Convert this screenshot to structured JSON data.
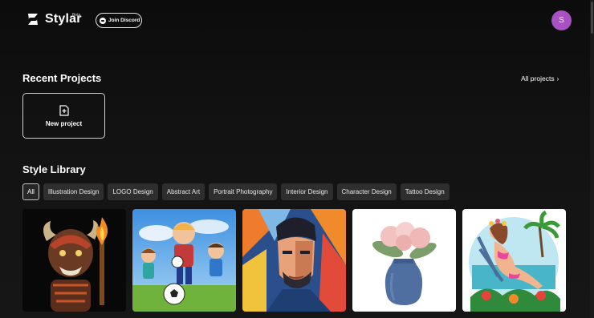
{
  "brand": {
    "name": "Stylar",
    "badge": "Beta"
  },
  "header": {
    "discord_label": "Join Discord",
    "avatar_initial": "S"
  },
  "recent": {
    "title": "Recent Projects",
    "all_projects_label": "All projects",
    "new_project_label": "New project"
  },
  "library": {
    "title": "Style Library",
    "categories": [
      "All",
      "Illustration Design",
      "LOGO Design",
      "Abstract Art",
      "Portrait Photography",
      "Interior Design",
      "Character Design",
      "Tattoo Design"
    ],
    "active_category": "All",
    "cards": [
      {
        "icon": "tiki-warrior-illustration"
      },
      {
        "icon": "kids-soccer-illustration"
      },
      {
        "icon": "geometric-portrait-illustration"
      },
      {
        "icon": "flower-vase-illustration"
      },
      {
        "icon": "beach-woman-illustration"
      }
    ]
  },
  "colors": {
    "background": "#111111",
    "avatar": "#a751c4",
    "chip": "#2e2e2e"
  }
}
